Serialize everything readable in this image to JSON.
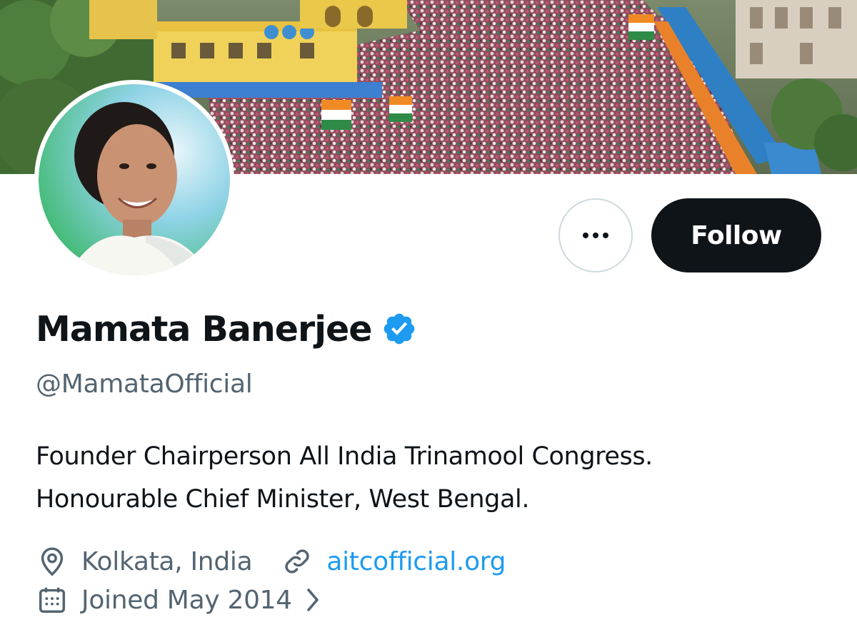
{
  "profile": {
    "display_name": "Mamata Banerjee",
    "verified": true,
    "handle": "@MamataOfficial",
    "bio_lines": [
      "Founder Chairperson All India Trinamool Congress.",
      "Honourable Chief Minister, West Bengal."
    ],
    "location": "Kolkata, India",
    "website": "aitcofficial.org",
    "joined": "Joined May 2014"
  },
  "actions": {
    "more_icon": "more-horizontal-icon",
    "follow_label": "Follow"
  },
  "icons": {
    "verified": "verified-badge-icon",
    "location": "location-pin-icon",
    "link": "link-icon",
    "calendar": "calendar-icon",
    "chevron": "chevron-right-icon"
  },
  "colors": {
    "text_primary": "#0f1419",
    "text_secondary": "#536471",
    "link": "#1d9bf0",
    "verified": "#1d9bf0",
    "follow_bg": "#0f1419",
    "follow_text": "#ffffff"
  }
}
